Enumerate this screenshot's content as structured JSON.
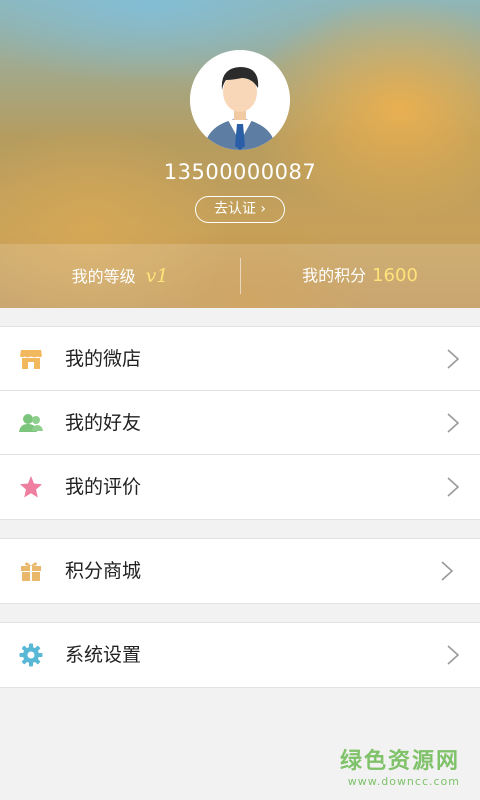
{
  "profile": {
    "phone": "13500000087",
    "verify_label": "去认证 ›"
  },
  "stats": {
    "level_label": "我的等级",
    "level_value": "v1",
    "points_label": "我的积分",
    "points_value": "1600"
  },
  "menu_group_1": [
    {
      "label": "我的微店",
      "icon": "shop-icon"
    },
    {
      "label": "我的好友",
      "icon": "friends-icon"
    },
    {
      "label": "我的评价",
      "icon": "star-icon"
    }
  ],
  "menu_group_2": [
    {
      "label": "积分商城",
      "icon": "gift-icon"
    }
  ],
  "menu_group_3": [
    {
      "label": "系统设置",
      "icon": "gear-icon"
    }
  ],
  "watermark": {
    "title": "绿色资源网",
    "url": "www.downcc.com"
  },
  "colors": {
    "shop": "#f2b85e",
    "friends": "#7cc57d",
    "star": "#ee7fa0",
    "gift": "#e9b86b",
    "gear": "#58b8d6",
    "points": "#ffe27a"
  }
}
